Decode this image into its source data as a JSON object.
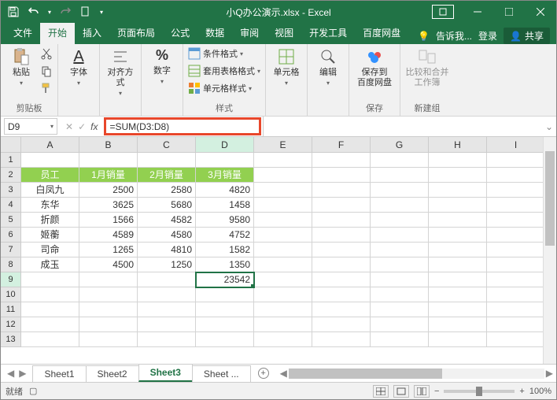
{
  "title": "小Q办公演示.xlsx - Excel",
  "tabs": {
    "file": "文件",
    "home": "开始",
    "insert": "插入",
    "layout": "页面布局",
    "formulas": "公式",
    "data": "数据",
    "review": "审阅",
    "view": "视图",
    "dev": "开发工具",
    "baidu": "百度网盘",
    "tell": "告诉我...",
    "login": "登录",
    "share": "共享"
  },
  "ribbon": {
    "clipboard": {
      "paste": "粘贴",
      "label": "剪贴板"
    },
    "font": {
      "btn": "字体",
      "label": ""
    },
    "align": {
      "btn": "对齐方式",
      "label": ""
    },
    "number": {
      "btn": "数字",
      "label": ""
    },
    "styles": {
      "cond": "条件格式",
      "tbl": "套用表格格式",
      "cell": "单元格样式",
      "label": "样式"
    },
    "cells": {
      "btn": "单元格",
      "label": ""
    },
    "editing": {
      "btn": "编辑",
      "label": ""
    },
    "save": {
      "btn": "保存到\n百度网盘",
      "label": "保存"
    },
    "newgroup": {
      "btn": "比较和合并\n工作簿",
      "label": "新建组"
    }
  },
  "namebox": "D9",
  "formula": "=SUM(D3:D8)",
  "columns": [
    "A",
    "B",
    "C",
    "D",
    "E",
    "F",
    "G",
    "H",
    "I"
  ],
  "rows": [
    "1",
    "2",
    "3",
    "4",
    "5",
    "6",
    "7",
    "8",
    "9",
    "10",
    "11",
    "12",
    "13"
  ],
  "header_row": [
    "员工",
    "1月销量",
    "2月销量",
    "3月销量"
  ],
  "data_rows": [
    [
      "白凤九",
      "2500",
      "2580",
      "4820"
    ],
    [
      "东华",
      "3625",
      "5680",
      "1458"
    ],
    [
      "折颜",
      "1566",
      "4582",
      "9580"
    ],
    [
      "姬蘅",
      "4589",
      "4580",
      "4752"
    ],
    [
      "司命",
      "1265",
      "4810",
      "1582"
    ],
    [
      "成玉",
      "4500",
      "1250",
      "1350"
    ]
  ],
  "sum_cell": "23542",
  "sheets": [
    "Sheet1",
    "Sheet2",
    "Sheet3",
    "Sheet ..."
  ],
  "sheet_add": "+",
  "status": {
    "ready": "就绪",
    "rec": "",
    "zoom": "100%"
  }
}
